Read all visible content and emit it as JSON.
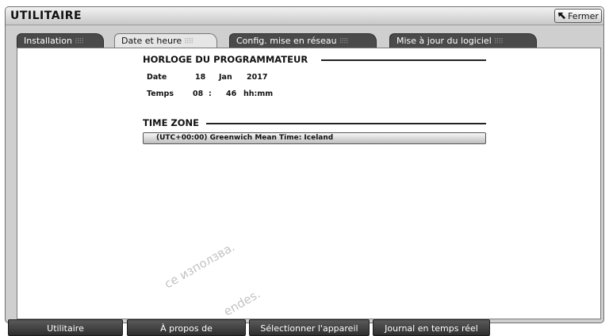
{
  "window": {
    "title": "UTILITAIRE",
    "close_label": "Fermer"
  },
  "tabs": [
    {
      "label": "Installation",
      "active": false
    },
    {
      "label": "Date et heure",
      "active": true
    },
    {
      "label": "Config. mise en réseau",
      "active": false
    },
    {
      "label": "Mise à jour du logiciel",
      "active": false
    }
  ],
  "clock": {
    "section_title": "HORLOGE DU PROGRAMMATEUR",
    "date_label": "Date",
    "day": "18",
    "month": "Jan",
    "year": "2017",
    "time_label": "Temps",
    "hours": "08",
    "separator": ":",
    "minutes": "46",
    "time_format": "hh:mm"
  },
  "timezone": {
    "section_title": "TIME ZONE",
    "selected": "(UTC+00:00) Greenwich Mean Time: Iceland"
  },
  "watermarks": [
    "ce използва.",
    "endes."
  ],
  "bottom_nav": [
    {
      "label": "Utilitaire"
    },
    {
      "label": "À propos de"
    },
    {
      "label": "Sélectionner l'appareil"
    },
    {
      "label": "Journal en temps réel"
    }
  ]
}
